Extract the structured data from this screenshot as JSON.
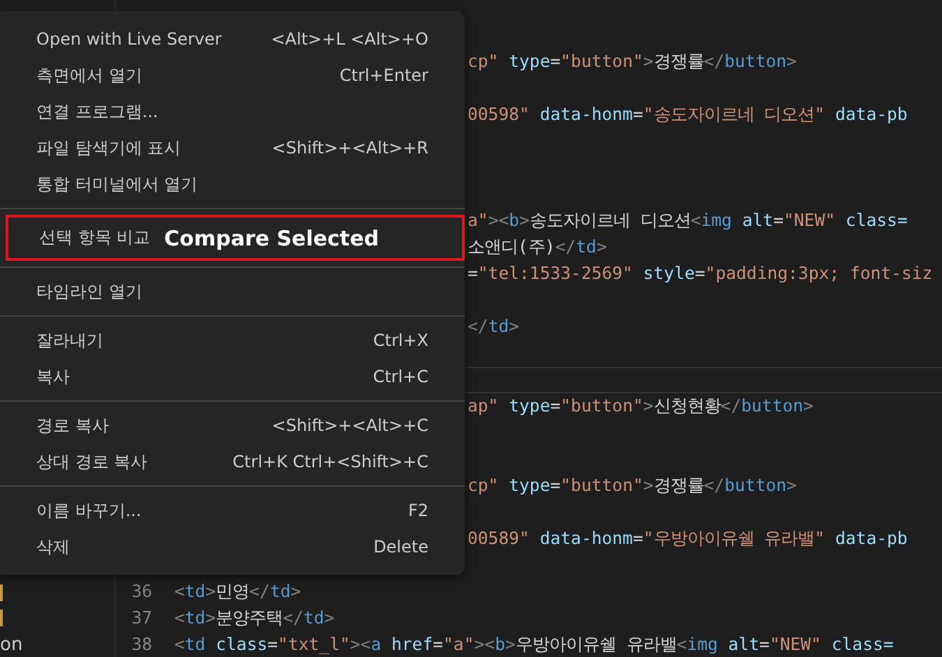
{
  "sidebar": {
    "items": [
      {
        "label": "on"
      }
    ]
  },
  "editor": {
    "lines": [
      {
        "kind": "blank"
      },
      {
        "kind": "blank"
      },
      {
        "kind": "clipped",
        "tokens": [
          {
            "kind": "str",
            "s": "cp\""
          },
          {
            "kind": "attr",
            "s": " type"
          },
          {
            "kind": "txt",
            "s": "="
          },
          {
            "kind": "str",
            "s": "\"button\""
          },
          {
            "kind": "p",
            "s": ">"
          },
          {
            "kind": "txt",
            "s": "경쟁률"
          },
          {
            "kind": "p",
            "s": "</"
          },
          {
            "kind": "tag",
            "s": "button"
          },
          {
            "kind": "p",
            "s": ">"
          }
        ]
      },
      {
        "kind": "blank"
      },
      {
        "kind": "clipped",
        "tokens": [
          {
            "kind": "str",
            "s": "00598\""
          },
          {
            "kind": "attr",
            "s": " data-honm"
          },
          {
            "kind": "txt",
            "s": "="
          },
          {
            "kind": "str",
            "s": "\"송도자이르네 디오션\""
          },
          {
            "kind": "attr",
            "s": " data-pb"
          }
        ]
      },
      {
        "kind": "blank"
      },
      {
        "kind": "blank"
      },
      {
        "kind": "blank"
      },
      {
        "kind": "clipped",
        "tokens": [
          {
            "kind": "str",
            "s": "a\""
          },
          {
            "kind": "p",
            "s": "><"
          },
          {
            "kind": "tag",
            "s": "b"
          },
          {
            "kind": "p",
            "s": ">"
          },
          {
            "kind": "txt",
            "s": "송도자이르네 디오션"
          },
          {
            "kind": "p",
            "s": "<"
          },
          {
            "kind": "tag",
            "s": "img"
          },
          {
            "kind": "attr",
            "s": " alt"
          },
          {
            "kind": "txt",
            "s": "="
          },
          {
            "kind": "str",
            "s": "\"NEW\""
          },
          {
            "kind": "attr",
            "s": " class="
          }
        ]
      },
      {
        "kind": "clipped",
        "tokens": [
          {
            "kind": "txt",
            "s": "소앤디(주)"
          },
          {
            "kind": "p",
            "s": "</"
          },
          {
            "kind": "tag",
            "s": "td"
          },
          {
            "kind": "p",
            "s": ">"
          }
        ]
      },
      {
        "kind": "clipped",
        "tokens": [
          {
            "kind": "txt",
            "s": "="
          },
          {
            "kind": "str",
            "s": "\"tel:1533-2569\""
          },
          {
            "kind": "attr",
            "s": " style"
          },
          {
            "kind": "txt",
            "s": "="
          },
          {
            "kind": "str",
            "s": "\"padding:3px; font-siz"
          }
        ]
      },
      {
        "kind": "blank"
      },
      {
        "kind": "clipped",
        "tokens": [
          {
            "kind": "p",
            "s": "</"
          },
          {
            "kind": "tag",
            "s": "td"
          },
          {
            "kind": "p",
            "s": ">"
          }
        ]
      },
      {
        "kind": "blank"
      },
      {
        "kind": "cursor"
      },
      {
        "kind": "clipped",
        "tokens": [
          {
            "kind": "str",
            "s": "ap\""
          },
          {
            "kind": "attr",
            "s": " type"
          },
          {
            "kind": "txt",
            "s": "="
          },
          {
            "kind": "str",
            "s": "\"button\""
          },
          {
            "kind": "p",
            "s": ">"
          },
          {
            "kind": "txt",
            "s": "신청현황"
          },
          {
            "kind": "p",
            "s": "</"
          },
          {
            "kind": "tag",
            "s": "button"
          },
          {
            "kind": "p",
            "s": ">"
          }
        ]
      },
      {
        "kind": "blank"
      },
      {
        "kind": "blank"
      },
      {
        "kind": "clipped",
        "tokens": [
          {
            "kind": "str",
            "s": "cp\""
          },
          {
            "kind": "attr",
            "s": " type"
          },
          {
            "kind": "txt",
            "s": "="
          },
          {
            "kind": "str",
            "s": "\"button\""
          },
          {
            "kind": "p",
            "s": ">"
          },
          {
            "kind": "txt",
            "s": "경쟁률"
          },
          {
            "kind": "p",
            "s": "</"
          },
          {
            "kind": "tag",
            "s": "button"
          },
          {
            "kind": "p",
            "s": ">"
          }
        ]
      },
      {
        "kind": "blank"
      },
      {
        "kind": "clipped",
        "tokens": [
          {
            "kind": "str",
            "s": "00589\""
          },
          {
            "kind": "attr",
            "s": " data-honm"
          },
          {
            "kind": "txt",
            "s": "="
          },
          {
            "kind": "str",
            "s": "\"우방아이유쉘 유라밸\""
          },
          {
            "kind": "attr",
            "s": " data-pb"
          }
        ]
      },
      {
        "kind": "blank"
      },
      {
        "kind": "code",
        "number": "36",
        "tokens": [
          {
            "kind": "p",
            "s": "<"
          },
          {
            "kind": "tag",
            "s": "td"
          },
          {
            "kind": "p",
            "s": ">"
          },
          {
            "kind": "txt",
            "s": "민영"
          },
          {
            "kind": "p",
            "s": "</"
          },
          {
            "kind": "tag",
            "s": "td"
          },
          {
            "kind": "p",
            "s": ">"
          }
        ]
      },
      {
        "kind": "code",
        "number": "37",
        "tokens": [
          {
            "kind": "p",
            "s": "<"
          },
          {
            "kind": "tag",
            "s": "td"
          },
          {
            "kind": "p",
            "s": ">"
          },
          {
            "kind": "txt",
            "s": "분양주택"
          },
          {
            "kind": "p",
            "s": "</"
          },
          {
            "kind": "tag",
            "s": "td"
          },
          {
            "kind": "p",
            "s": ">"
          }
        ]
      },
      {
        "kind": "code",
        "number": "38",
        "tokens": [
          {
            "kind": "p",
            "s": "<"
          },
          {
            "kind": "tag",
            "s": "td"
          },
          {
            "kind": "attr",
            "s": " class"
          },
          {
            "kind": "txt",
            "s": "="
          },
          {
            "kind": "str",
            "s": "\"txt_l\""
          },
          {
            "kind": "p",
            "s": "><"
          },
          {
            "kind": "tag",
            "s": "a"
          },
          {
            "kind": "attr",
            "s": " href"
          },
          {
            "kind": "txt",
            "s": "="
          },
          {
            "kind": "str",
            "s": "\"a\""
          },
          {
            "kind": "p",
            "s": "><"
          },
          {
            "kind": "tag",
            "s": "b"
          },
          {
            "kind": "p",
            "s": ">"
          },
          {
            "kind": "txt",
            "s": "우방아이유쉘 유라밸"
          },
          {
            "kind": "p",
            "s": "<"
          },
          {
            "kind": "tag",
            "s": "img"
          },
          {
            "kind": "attr",
            "s": " alt"
          },
          {
            "kind": "txt",
            "s": "="
          },
          {
            "kind": "str",
            "s": "\"NEW\""
          },
          {
            "kind": "attr",
            "s": " class="
          }
        ]
      }
    ]
  },
  "context_menu": {
    "groups": [
      [
        {
          "label": "Open with Live Server",
          "shortcut": "<Alt>+L <Alt>+O",
          "highlighted": false
        },
        {
          "label": "측면에서 열기",
          "shortcut": "Ctrl+Enter",
          "highlighted": false
        },
        {
          "label": "연결 프로그램...",
          "highlighted": false
        },
        {
          "label": "파일 탐색기에 표시",
          "shortcut": "<Shift>+<Alt>+R",
          "highlighted": false
        },
        {
          "label": "통합 터미널에서 열기",
          "highlighted": false
        }
      ],
      [
        {
          "label": "선택 항목 비교",
          "callout": "Compare Selected",
          "highlighted": true
        }
      ],
      [
        {
          "label": "타임라인 열기",
          "highlighted": false
        }
      ],
      [
        {
          "label": "잘라내기",
          "shortcut": "Ctrl+X",
          "highlighted": false
        },
        {
          "label": "복사",
          "shortcut": "Ctrl+C",
          "highlighted": false
        }
      ],
      [
        {
          "label": "경로 복사",
          "shortcut": "<Shift>+<Alt>+C",
          "highlighted": false
        },
        {
          "label": "상대 경로 복사",
          "shortcut": "Ctrl+K Ctrl+<Shift>+C",
          "highlighted": false
        }
      ],
      [
        {
          "label": "이름 바꾸기...",
          "shortcut": "F2",
          "highlighted": false
        },
        {
          "label": "삭제",
          "shortcut": "Delete",
          "highlighted": false
        }
      ]
    ]
  }
}
